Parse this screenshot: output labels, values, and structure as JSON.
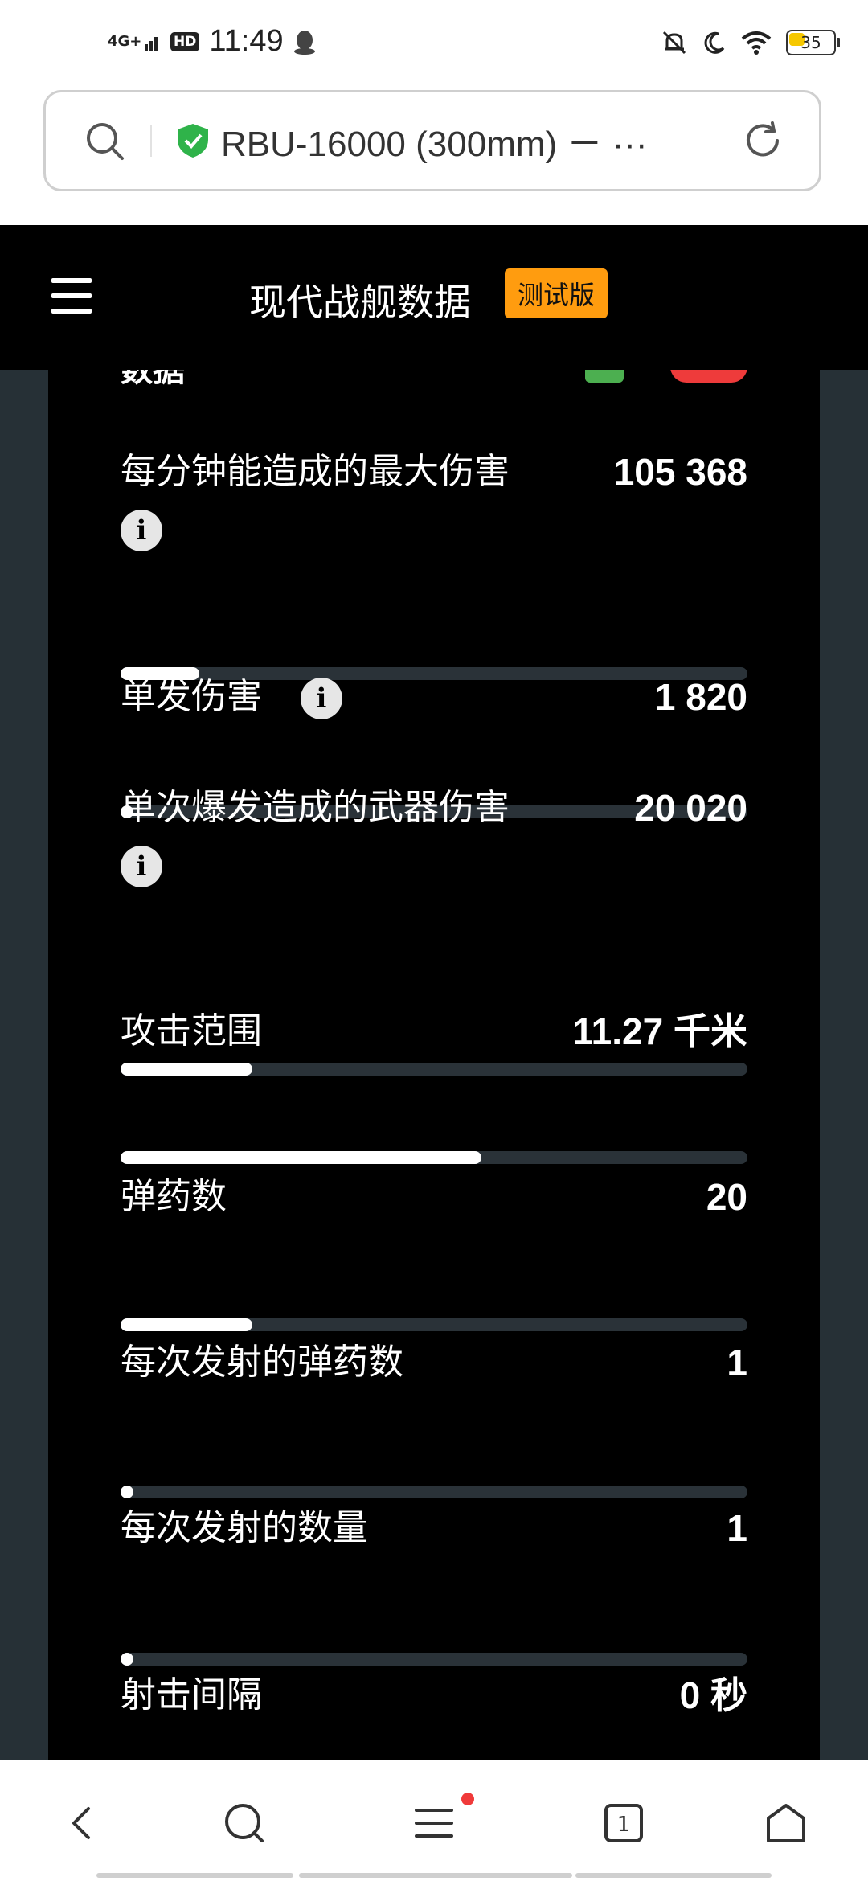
{
  "status_bar": {
    "network": "4G+",
    "hd": "HD",
    "time": "11:49",
    "battery": "35",
    "battery_level": 0.35
  },
  "browser": {
    "page_title": "RBU-16000 (300mm) －  ···"
  },
  "app": {
    "title": "现代战舰数据",
    "badge": "测试版"
  },
  "card": {
    "partial_heading": "数据"
  },
  "stats": [
    {
      "label": "每分钟能造成的最大伤害",
      "value": "105 368",
      "fill": 0.125,
      "info": true
    },
    {
      "label": "单发伤害",
      "value": "1 820",
      "fill": 0.02,
      "info": true
    },
    {
      "label": "单次爆发造成的武器伤害",
      "value": "20 020",
      "fill": 0.21,
      "info": true
    },
    {
      "label": "攻击范围",
      "value": "11.27 千米",
      "fill": 0.575,
      "info": false
    },
    {
      "label": "弹药数",
      "value": "20",
      "fill": 0.21,
      "info": false
    },
    {
      "label": "每次发射的弹药数",
      "value": "1",
      "fill": 0.02,
      "info": false
    },
    {
      "label": "每次发射的数量",
      "value": "1",
      "fill": 0.02,
      "info": false
    },
    {
      "label": "射击间隔",
      "value": "0 秒",
      "fill": 0,
      "info": false
    }
  ],
  "colors": {
    "accent_orange": "#ff9c0f",
    "card_bg": "#000000",
    "page_bg": "#263036",
    "track": "#2a3238",
    "fill": "#ffffff"
  }
}
